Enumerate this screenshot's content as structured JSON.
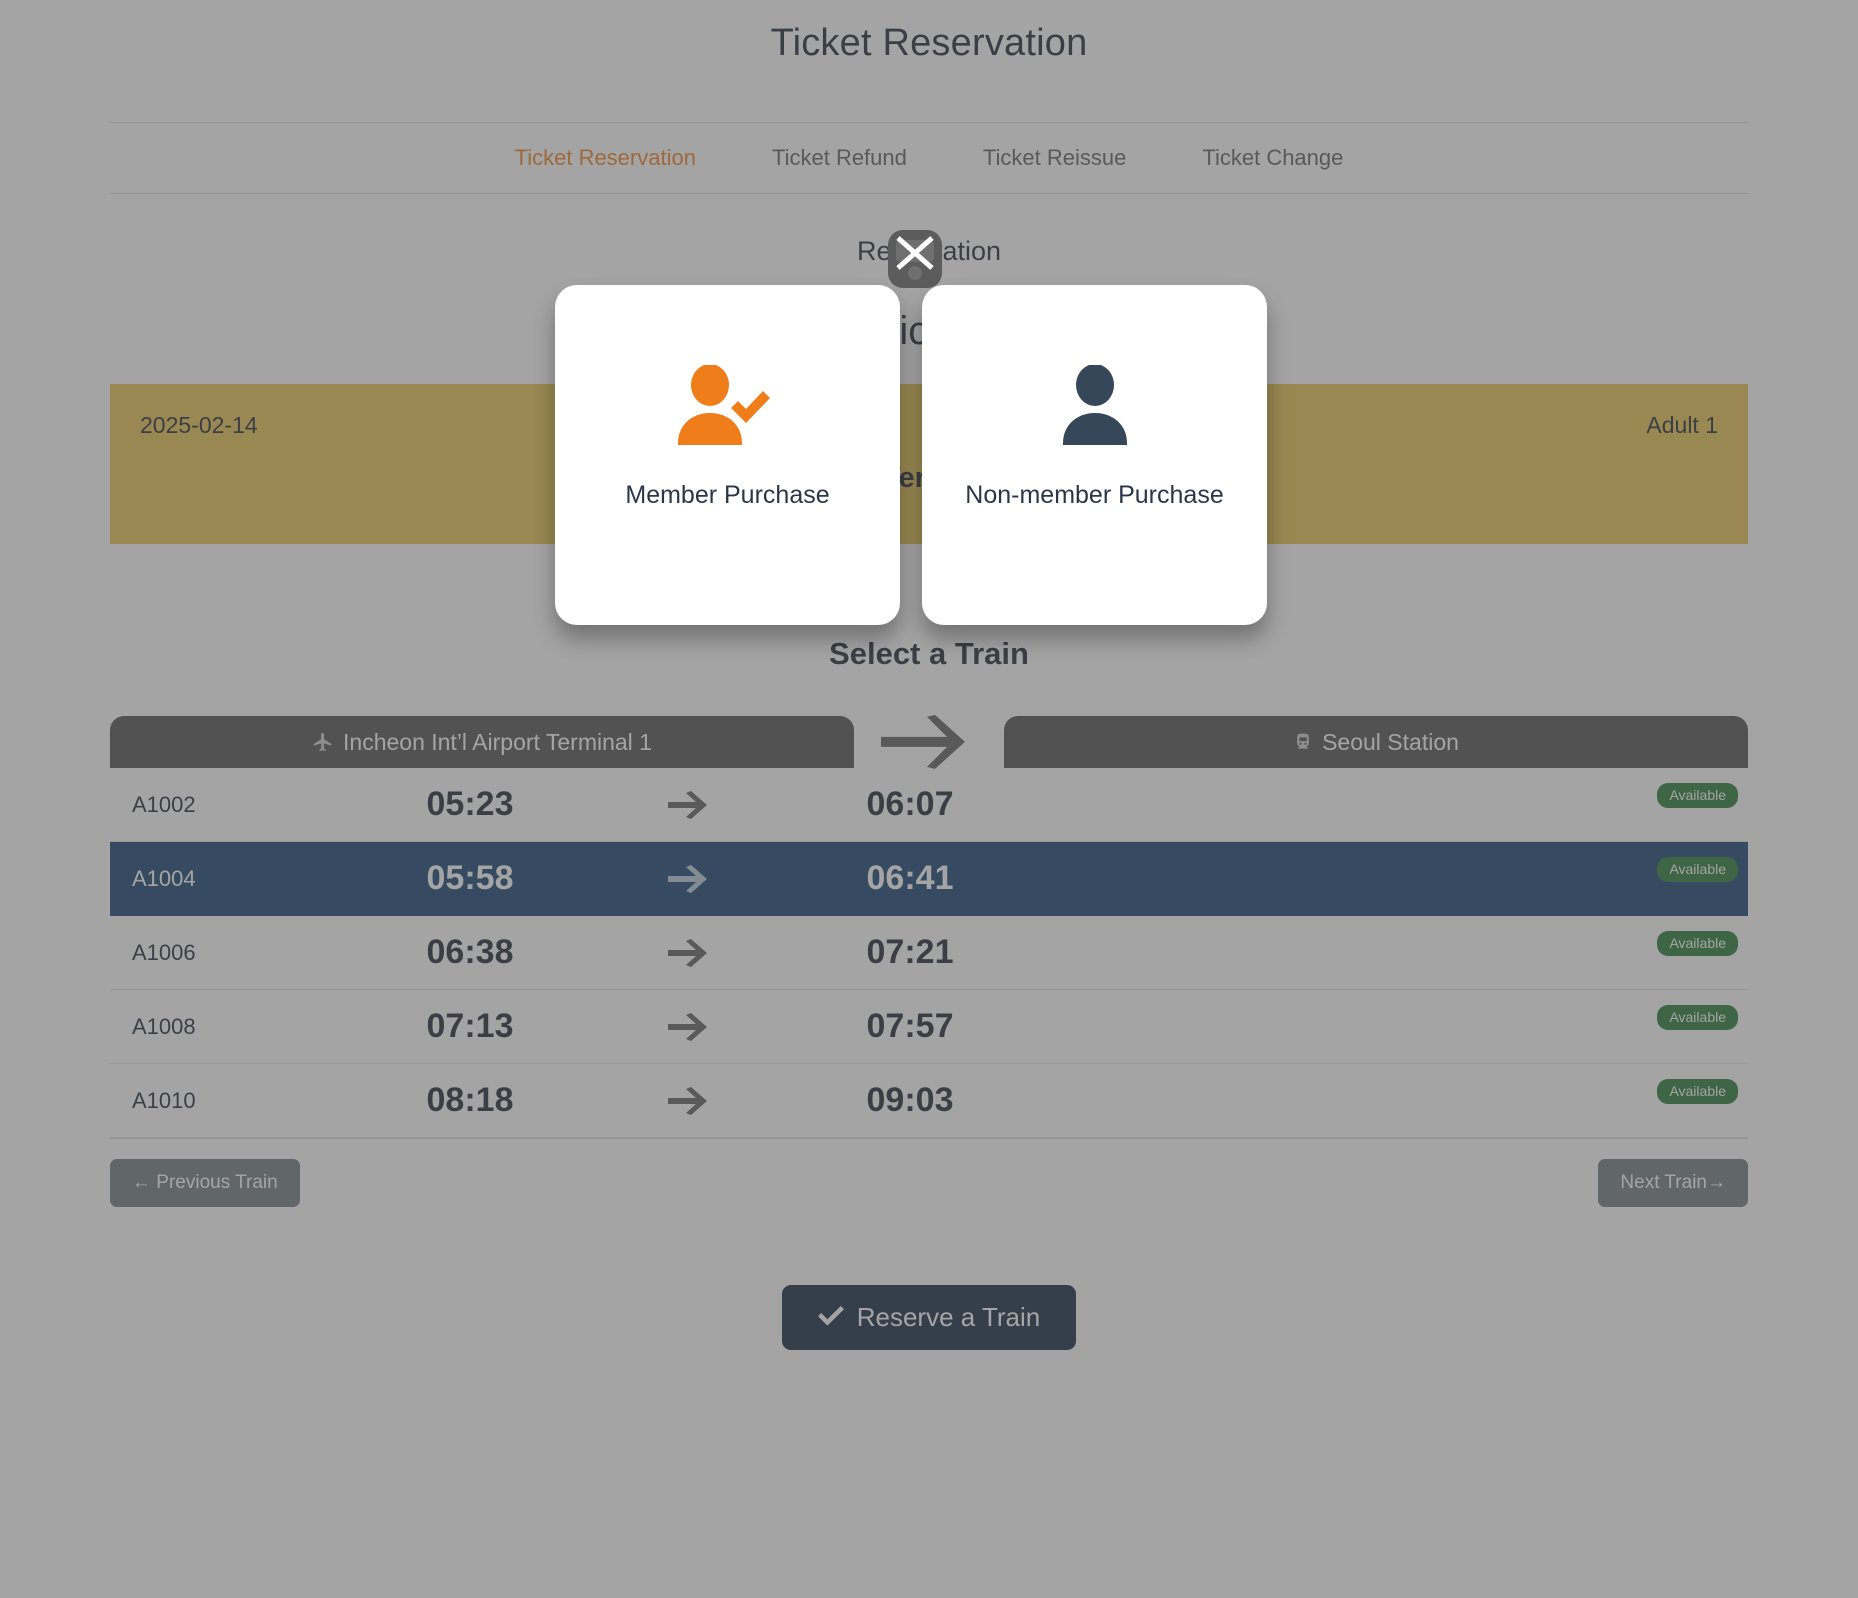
{
  "header": {
    "title": "Ticket Reservation"
  },
  "tabs": [
    {
      "label": "Ticket Reservation",
      "active": true
    },
    {
      "label": "Ticket Refund",
      "active": false
    },
    {
      "label": "Ticket Reissue",
      "active": false
    },
    {
      "label": "Ticket Change",
      "active": false
    }
  ],
  "info": {
    "heading": "Reservation",
    "subheading": "Ticket"
  },
  "summary": {
    "date": "2025-02-14",
    "passengers": "Adult 1",
    "route": "Incheon Int'l Airport Terminal 1 → Seoul Station"
  },
  "select_train": {
    "title": "Select a Train",
    "origin_station": "Incheon Int’l Airport Terminal 1",
    "destination_station": "Seoul Station",
    "origin_icon": "airplane-icon",
    "destination_icon": "train-icon",
    "arrow_icon": "arrow-right-icon",
    "rows": [
      {
        "code": "A1002",
        "depart": "05:23",
        "arrive": "06:07",
        "status": "Available",
        "selected": false
      },
      {
        "code": "A1004",
        "depart": "05:58",
        "arrive": "06:41",
        "status": "Available",
        "selected": true
      },
      {
        "code": "A1006",
        "depart": "06:38",
        "arrive": "07:21",
        "status": "Available",
        "selected": false
      },
      {
        "code": "A1008",
        "depart": "07:13",
        "arrive": "07:57",
        "status": "Available",
        "selected": false
      },
      {
        "code": "A1010",
        "depart": "08:18",
        "arrive": "09:03",
        "status": "Available",
        "selected": false
      }
    ]
  },
  "pager": {
    "previous_label": "← Previous Train",
    "next_label": "Next Train→"
  },
  "footer": {
    "reserve_label": "Reserve a Train",
    "reserve_icon": "check-icon"
  },
  "modal": {
    "close_icon": "close-icon",
    "cards": [
      {
        "label": "Member Purchase",
        "icon": "member-user-check-icon",
        "icon_color": "#ef7d1a"
      },
      {
        "label": "Non-member Purchase",
        "icon": "user-icon",
        "icon_color": "#37475a"
      }
    ]
  },
  "colors": {
    "accent": "#ef7d1a",
    "selected_row": "#0c3b6b",
    "badge_green": "#1c7430",
    "reserve_button": "#0a1f3c",
    "station_pill": "#4b4b4b",
    "summary_bar": "#e8c24a"
  }
}
